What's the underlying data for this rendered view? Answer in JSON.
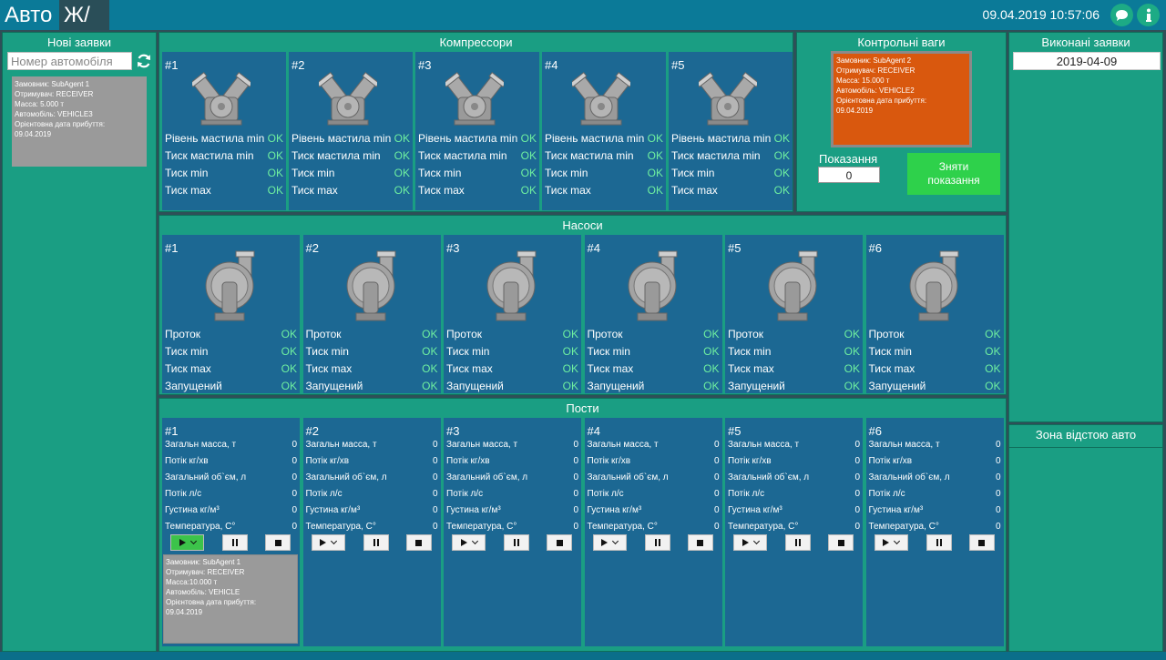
{
  "header": {
    "tabs": [
      {
        "label": "Авто"
      },
      {
        "label": "Ж/Д"
      }
    ],
    "datetime": "09.04.2019 10:57:06",
    "icons": [
      "chat-icon",
      "info-icon"
    ]
  },
  "new_requests": {
    "title": "Нові заявки",
    "search_placeholder": "Номер автомобіля",
    "card": [
      "Замовник: SubAgent 1",
      "Отримувач: RECEIVER",
      "Масса: 5.000 т",
      "Автомобіль: VEHICLE3",
      "Орієнтовна дата прибуття:",
      "09.04.2019"
    ]
  },
  "compressors": {
    "title": "Компрессори",
    "labels": [
      "Рівень мастила min",
      "Тиск мастила min",
      "Тиск min",
      "Тиск max"
    ],
    "items": [
      {
        "num": "#1",
        "status": [
          "OK",
          "OK",
          "OK",
          "OK"
        ]
      },
      {
        "num": "#2",
        "status": [
          "OK",
          "OK",
          "OK",
          "OK"
        ]
      },
      {
        "num": "#3",
        "status": [
          "OK",
          "OK",
          "OK",
          "OK"
        ]
      },
      {
        "num": "#4",
        "status": [
          "OK",
          "OK",
          "OK",
          "OK"
        ]
      },
      {
        "num": "#5",
        "status": [
          "OK",
          "OK",
          "OK",
          "OK"
        ]
      }
    ]
  },
  "scales": {
    "title": "Контрольні ваги",
    "card": [
      "Замовник: SubAgent 2",
      "Отримувач: RECEIVER",
      "Масса: 15.000 т",
      "Автомобіль: VEHICLE2",
      "Орієнтовна дата прибуття:",
      "09.04.2019"
    ],
    "readings_label": "Показання",
    "readings_value": "0",
    "take_button": [
      "Зняти",
      "показання"
    ]
  },
  "completed": {
    "title": "Виконані заявки",
    "date": "2019-04-09"
  },
  "parking": {
    "title": "Зона відстою авто"
  },
  "pumps": {
    "title": "Насоси",
    "labels": [
      "Проток",
      "Тиск min",
      "Тиск max",
      "Запущений"
    ],
    "items": [
      {
        "num": "#1",
        "status": [
          "OK",
          "OK",
          "OK",
          "OK"
        ]
      },
      {
        "num": "#2",
        "status": [
          "OK",
          "OK",
          "OK",
          "OK"
        ]
      },
      {
        "num": "#3",
        "status": [
          "OK",
          "OK",
          "OK",
          "OK"
        ]
      },
      {
        "num": "#4",
        "status": [
          "OK",
          "OK",
          "OK",
          "OK"
        ]
      },
      {
        "num": "#5",
        "status": [
          "OK",
          "OK",
          "OK",
          "OK"
        ]
      },
      {
        "num": "#6",
        "status": [
          "OK",
          "OK",
          "OK",
          "OK"
        ]
      }
    ]
  },
  "posts": {
    "title": "Пости",
    "labels": [
      "Загальн масса, т",
      "Потік кг/хв",
      "Загальний об`єм, л",
      "Потік л/с",
      "Густина кг/м³",
      "Температура, С°"
    ],
    "items": [
      {
        "num": "#1",
        "values": [
          "0",
          "0",
          "0",
          "0",
          "0",
          "0"
        ],
        "active": true
      },
      {
        "num": "#2",
        "values": [
          "0",
          "0",
          "0",
          "0",
          "0",
          "0"
        ],
        "active": false
      },
      {
        "num": "#3",
        "values": [
          "0",
          "0",
          "0",
          "0",
          "0",
          "0"
        ],
        "active": false
      },
      {
        "num": "#4",
        "values": [
          "0",
          "0",
          "0",
          "0",
          "0",
          "0"
        ],
        "active": false
      },
      {
        "num": "#5",
        "values": [
          "0",
          "0",
          "0",
          "0",
          "0",
          "0"
        ],
        "active": false
      },
      {
        "num": "#6",
        "values": [
          "0",
          "0",
          "0",
          "0",
          "0",
          "0"
        ],
        "active": false
      }
    ],
    "card": [
      "Замовник: SubAgent 1",
      "Отримувач: RECEIVER",
      "Масса:10.000 т",
      "Автомобіль: VEHICLE",
      "Орієнтовна дата прибуття:",
      "09.04.2019"
    ]
  },
  "colors": {
    "header": "#0b7a98",
    "panel": "#1a9e83",
    "tile": "#1c6893",
    "ok": "#6ff0a0",
    "scale_card": "#d9580e",
    "take_button": "#2ed14b"
  }
}
